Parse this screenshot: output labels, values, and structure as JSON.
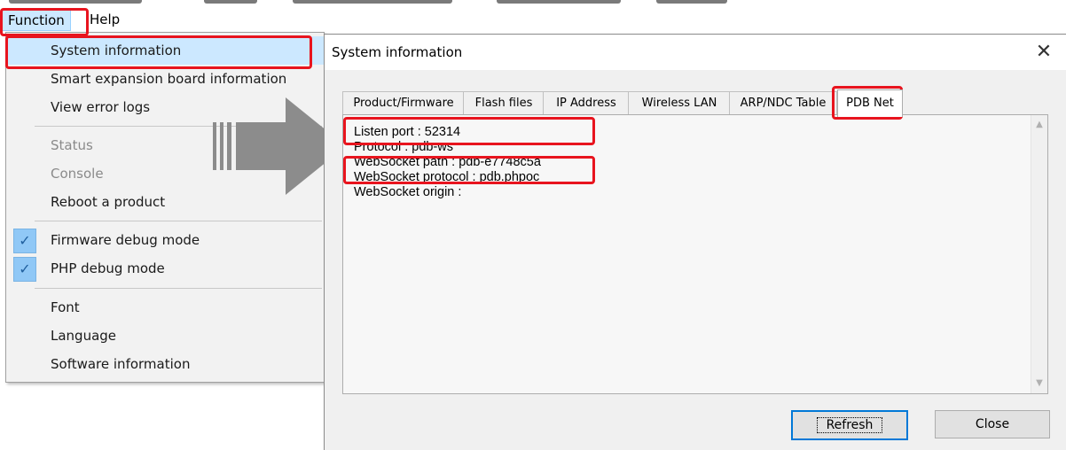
{
  "menubar": {
    "items": [
      "Function",
      "Help"
    ]
  },
  "function_menu": {
    "items": [
      {
        "label": "System information",
        "state": "highlighted"
      },
      {
        "label": "Smart expansion board information"
      },
      {
        "label": "View error logs"
      },
      {
        "label": "Status",
        "state": "disabled"
      },
      {
        "label": "Console",
        "state": "disabled"
      },
      {
        "label": "Reboot a product"
      },
      {
        "label": "Firmware debug mode",
        "checked": true
      },
      {
        "label": "PHP debug mode",
        "checked": true
      },
      {
        "label": "Font"
      },
      {
        "label": "Language"
      },
      {
        "label": "Software information"
      }
    ],
    "check_glyph": "✓"
  },
  "dialog": {
    "title": "System information",
    "close_glyph": "✕",
    "tabs": [
      "Product/Firmware",
      "Flash files",
      "IP Address",
      "Wireless LAN",
      "ARP/NDC Table",
      "PDB Net"
    ],
    "active_tab": "PDB Net",
    "fields": [
      "Listen port : 52314",
      "Protocol : pdb-ws",
      "WebSocket path : pdb-e7748c5a",
      "WebSocket protocol : pdb.phpoc",
      "WebSocket origin :"
    ],
    "buttons": {
      "refresh": "Refresh",
      "close": "Close"
    }
  },
  "colors": {
    "highlight": "#e8141e",
    "menu_hover": "#cce8ff",
    "arrow": "#8c8c8c"
  }
}
